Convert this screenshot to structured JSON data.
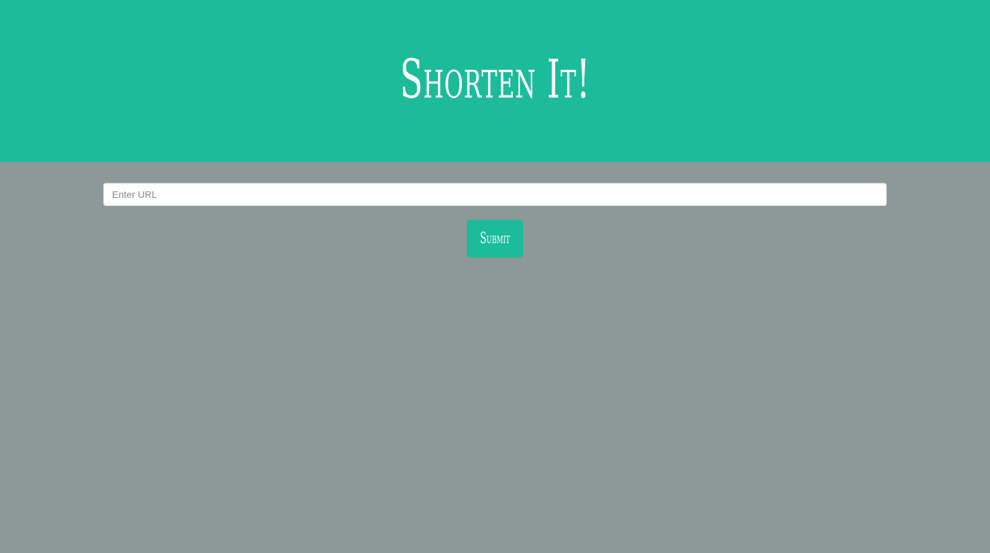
{
  "header": {
    "title": "Shorten It!",
    "background_color": "#1cbc9b",
    "text_color": "#ffffff"
  },
  "form": {
    "url_input": {
      "placeholder": "Enter URL",
      "value": ""
    },
    "submit_label": "Submit",
    "submit_color": "#1cbc9b"
  },
  "page": {
    "background_color": "#8d9899"
  }
}
